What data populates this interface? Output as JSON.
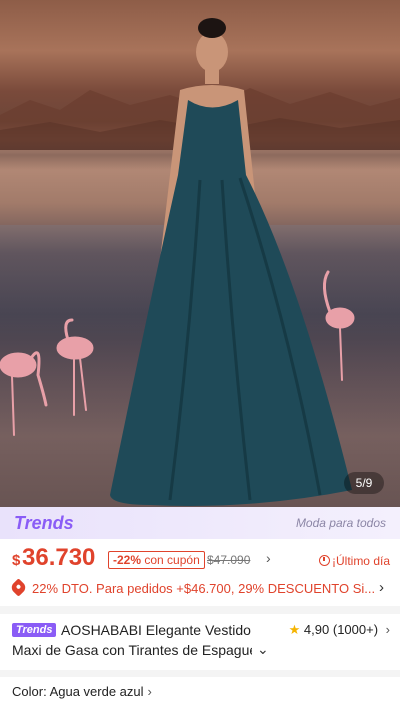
{
  "gallery": {
    "counter": "5/9"
  },
  "trends": {
    "logo": "Trends",
    "tagline": "Moda para todos"
  },
  "price": {
    "currency": "$",
    "amount": "36.730",
    "discount_percent": "-22%",
    "discount_label": "con cupón",
    "original": "$47.090",
    "chevron": "›",
    "urgency": "¡Último día"
  },
  "promo": {
    "text": "22% DTO. Para pedidos +$46.700,  29% DESCUENTO Si...",
    "chevron": "›"
  },
  "product": {
    "badge": "Trends",
    "title_line1": "AOSHABABI Elegante Vestido",
    "title_line2": "Maxi de Gasa con Tirantes de Espagueti",
    "rating": "4,90",
    "reviews": "(1000+)"
  },
  "variant": {
    "color_label": "Color: Agua verde azul"
  },
  "colors": {
    "accent": "#e0432c",
    "trends": "#8a5cf6",
    "dress": "#1f4a58"
  },
  "icons": [
    "star-icon",
    "clock-icon",
    "tag-icon",
    "chevron-right-icon",
    "chevron-down-icon"
  ]
}
